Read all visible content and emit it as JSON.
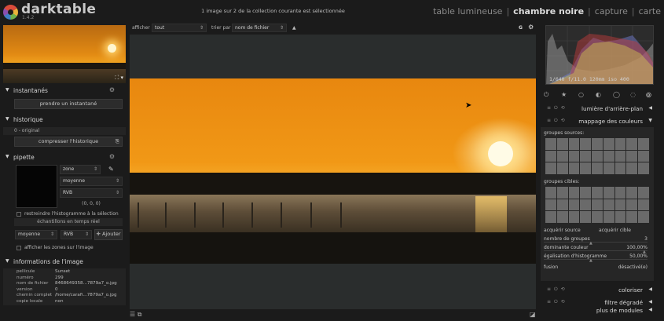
{
  "app": {
    "name": "darktable",
    "version": "1.4.2"
  },
  "status": "1 image sur 2 de la collection courante est sélectionnée",
  "views": [
    {
      "label": "table lumineuse",
      "active": false
    },
    {
      "label": "chambre noire",
      "active": true
    },
    {
      "label": "capture",
      "active": false
    },
    {
      "label": "carte",
      "active": false
    }
  ],
  "view_separator": "|",
  "topbar": {
    "show_label": "afficher",
    "show_value": "tout",
    "sort_label": "trier par",
    "sort_value": "nom de fichier",
    "sort_dir": "▲",
    "grouping": "G",
    "prefs": "⚙"
  },
  "left": {
    "thumb_icons": "⛶ ▾",
    "snapshots": {
      "title": "instantanés",
      "button": "prendre un instantané"
    },
    "history": {
      "title": "historique",
      "item": "0 - original",
      "compress": "compresser l'historique",
      "compress_icon": "⎘"
    },
    "picker": {
      "title": "pipette",
      "mode": "zone",
      "stat": "moyenne",
      "colorspace": "RVB",
      "values": "(0, 0, 0)",
      "restrict": "restreindre l'histogramme à la sélection",
      "realtime": "échantillons en temps réel",
      "stat2": "moyenne",
      "colorspace2": "RVB",
      "add": "Ajouter",
      "show_zones": "afficher les zones sur l'image"
    },
    "image_info": {
      "title": "informations de l'image",
      "rows": [
        {
          "k": "pellicule",
          "v": "Sunset"
        },
        {
          "k": "numéro",
          "v": "299"
        },
        {
          "k": "nom de fichier",
          "v": "8468649358...7879a7_o.jpg"
        },
        {
          "k": "version",
          "v": "0"
        },
        {
          "k": "chemin complet",
          "v": "/home/carafi...7879a7_o.jpg"
        },
        {
          "k": "copie locale",
          "v": "non"
        }
      ]
    }
  },
  "bottom_icons": {
    "left": "☰ ⧉",
    "right": "◪"
  },
  "right": {
    "histogram_info": "1/640 f/11.0 120mm iso 400",
    "group_icons": [
      "⏻",
      "★",
      "○",
      "◐",
      "◯",
      "◌",
      "◎"
    ],
    "modules": [
      {
        "title": "lumière d'arrière-plan",
        "expanded": false
      },
      {
        "title": "mappage des couleurs",
        "expanded": true
      }
    ],
    "color_mapping": {
      "source_label": "groupes sources:",
      "target_label": "groupes cibles:",
      "acquire_source": "acquérir source",
      "acquire_target": "acquérir cible",
      "rows": [
        {
          "label": "nombre de groupes",
          "value": "3"
        },
        {
          "label": "dominante couleur",
          "value": "100,00%"
        },
        {
          "label": "égalisation d'histogramme",
          "value": "50,00%"
        }
      ],
      "blend_label": "fusion",
      "blend_value": "désactivé(e)"
    },
    "modules_after": [
      {
        "title": "coloriser",
        "expanded": false
      },
      {
        "title": "filtre dégradé",
        "expanded": false
      }
    ],
    "more_modules": "plus de modules"
  },
  "colors": {
    "accent_sunset": "#f19816",
    "panel_bg": "#1b1b1b",
    "module_bg": "#262626"
  }
}
